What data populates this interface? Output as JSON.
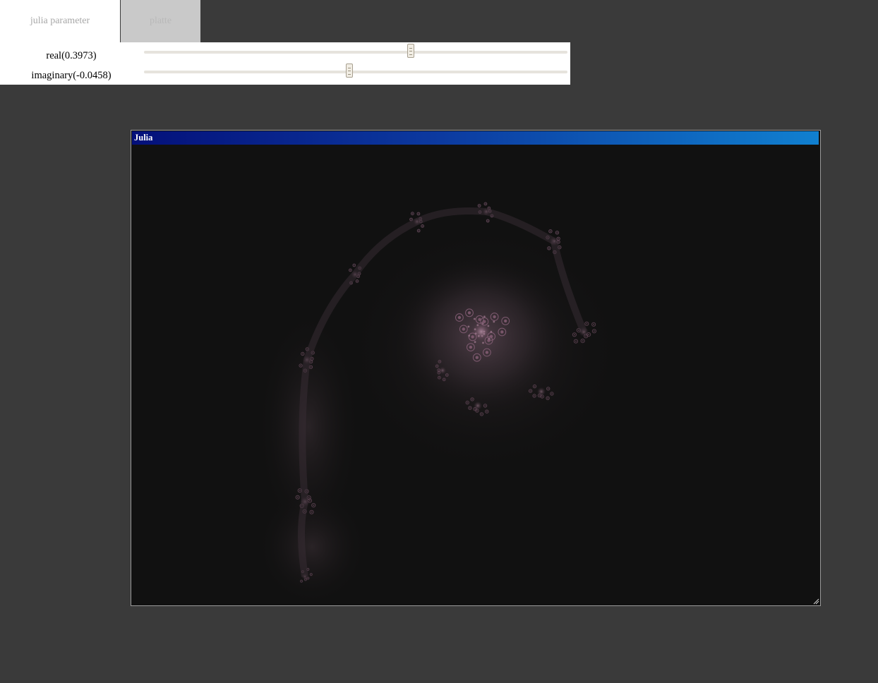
{
  "tabs": [
    {
      "label": "julia parameter",
      "active": true
    },
    {
      "label": "platte",
      "active": false
    }
  ],
  "params": {
    "real": {
      "label": "real(0.3973)",
      "value": 0.3973,
      "slider_fraction": 0.63
    },
    "imaginary": {
      "label": "imaginary(-0.0458)",
      "value": -0.0458,
      "slider_fraction": 0.485
    }
  },
  "window": {
    "title": "Julia"
  },
  "colors": {
    "background": "#3a3a3a",
    "fractal_bg": "#111111",
    "fractal_glow": "#4a3a44",
    "fractal_detail": "#8a5f78",
    "titlebar_start": "#04107a",
    "titlebar_end": "#1080d0"
  },
  "icons": {
    "resize_grip": "resize-grip-icon",
    "slider_handle": "slider-grip-icon"
  }
}
